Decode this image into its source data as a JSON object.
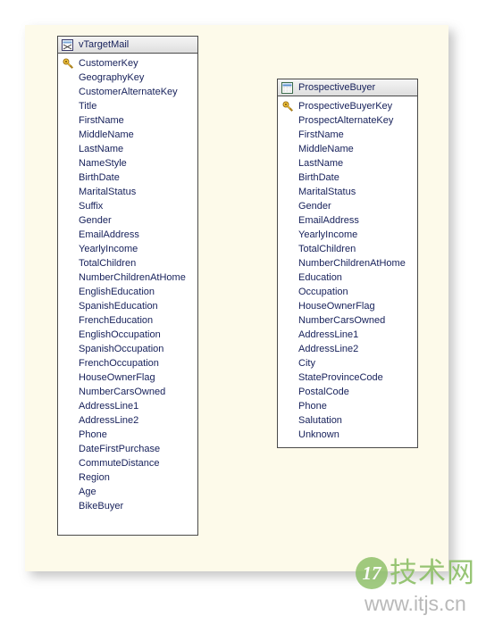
{
  "canvas": {
    "background_color": "#fdfaea",
    "page_background_color": "#ffffff"
  },
  "entities": [
    {
      "name": "vTargetMail",
      "icon": "view-icon",
      "fields": [
        {
          "name": "CustomerKey",
          "icon": "primary-key-icon"
        },
        {
          "name": "GeographyKey",
          "icon": ""
        },
        {
          "name": "CustomerAlternateKey",
          "icon": ""
        },
        {
          "name": "Title",
          "icon": ""
        },
        {
          "name": "FirstName",
          "icon": ""
        },
        {
          "name": "MiddleName",
          "icon": ""
        },
        {
          "name": "LastName",
          "icon": ""
        },
        {
          "name": "NameStyle",
          "icon": ""
        },
        {
          "name": "BirthDate",
          "icon": ""
        },
        {
          "name": "MaritalStatus",
          "icon": ""
        },
        {
          "name": "Suffix",
          "icon": ""
        },
        {
          "name": "Gender",
          "icon": ""
        },
        {
          "name": "EmailAddress",
          "icon": ""
        },
        {
          "name": "YearlyIncome",
          "icon": ""
        },
        {
          "name": "TotalChildren",
          "icon": ""
        },
        {
          "name": "NumberChildrenAtHome",
          "icon": ""
        },
        {
          "name": "EnglishEducation",
          "icon": ""
        },
        {
          "name": "SpanishEducation",
          "icon": ""
        },
        {
          "name": "FrenchEducation",
          "icon": ""
        },
        {
          "name": "EnglishOccupation",
          "icon": ""
        },
        {
          "name": "SpanishOccupation",
          "icon": ""
        },
        {
          "name": "FrenchOccupation",
          "icon": ""
        },
        {
          "name": "HouseOwnerFlag",
          "icon": ""
        },
        {
          "name": "NumberCarsOwned",
          "icon": ""
        },
        {
          "name": "AddressLine1",
          "icon": ""
        },
        {
          "name": "AddressLine2",
          "icon": ""
        },
        {
          "name": "Phone",
          "icon": ""
        },
        {
          "name": "DateFirstPurchase",
          "icon": ""
        },
        {
          "name": "CommuteDistance",
          "icon": ""
        },
        {
          "name": "Region",
          "icon": ""
        },
        {
          "name": "Age",
          "icon": ""
        },
        {
          "name": "BikeBuyer",
          "icon": ""
        }
      ]
    },
    {
      "name": "ProspectiveBuyer",
      "icon": "table-icon",
      "fields": [
        {
          "name": "ProspectiveBuyerKey",
          "icon": "primary-key-icon"
        },
        {
          "name": "ProspectAlternateKey",
          "icon": ""
        },
        {
          "name": "FirstName",
          "icon": ""
        },
        {
          "name": "MiddleName",
          "icon": ""
        },
        {
          "name": "LastName",
          "icon": ""
        },
        {
          "name": "BirthDate",
          "icon": ""
        },
        {
          "name": "MaritalStatus",
          "icon": ""
        },
        {
          "name": "Gender",
          "icon": ""
        },
        {
          "name": "EmailAddress",
          "icon": ""
        },
        {
          "name": "YearlyIncome",
          "icon": ""
        },
        {
          "name": "TotalChildren",
          "icon": ""
        },
        {
          "name": "NumberChildrenAtHome",
          "icon": ""
        },
        {
          "name": "Education",
          "icon": ""
        },
        {
          "name": "Occupation",
          "icon": ""
        },
        {
          "name": "HouseOwnerFlag",
          "icon": ""
        },
        {
          "name": "NumberCarsOwned",
          "icon": ""
        },
        {
          "name": "AddressLine1",
          "icon": ""
        },
        {
          "name": "AddressLine2",
          "icon": ""
        },
        {
          "name": "City",
          "icon": ""
        },
        {
          "name": "StateProvinceCode",
          "icon": ""
        },
        {
          "name": "PostalCode",
          "icon": ""
        },
        {
          "name": "Phone",
          "icon": ""
        },
        {
          "name": "Salutation",
          "icon": ""
        },
        {
          "name": "Unknown",
          "icon": ""
        }
      ]
    }
  ],
  "watermark": {
    "badge": "17",
    "site_name": "技术网",
    "url": "www.itjs.cn",
    "color": "#8cbf66"
  }
}
